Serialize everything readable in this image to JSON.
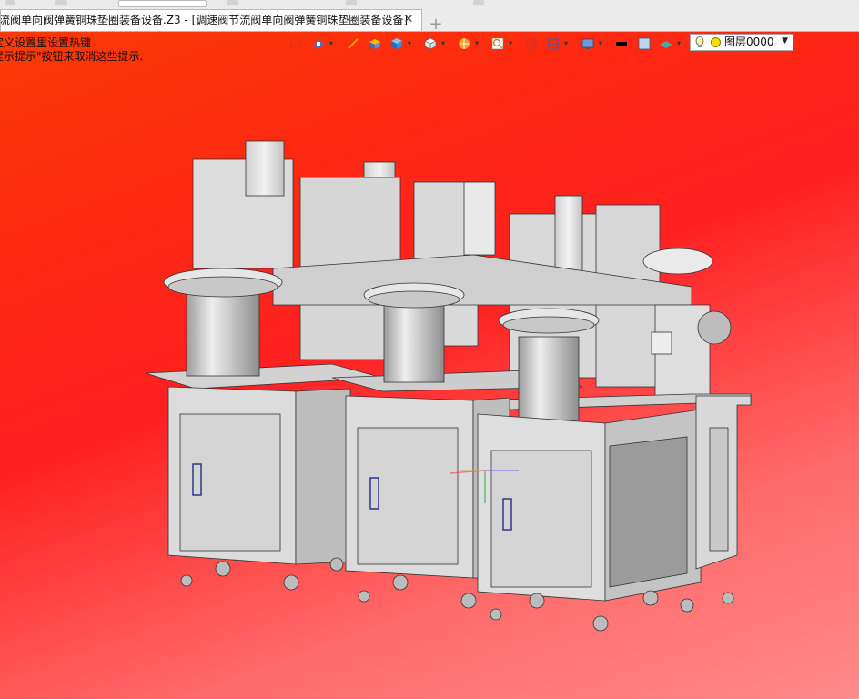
{
  "window": {
    "active_tab_title": "流阀单向阀弹簧铜珠垫圈装备设备.Z3 - [调速阀节流阀单向阀弹簧铜珠垫圈装备设备]",
    "close_glyph": "✕",
    "add_tab_glyph": "+"
  },
  "viewport": {
    "hint_line1": "定义设置里设置热键",
    "hint_line2": "提示提示\"按钮来取消这些提示.",
    "background_colors": [
      "#fb3a05",
      "#ff2020",
      "#ff8a8a"
    ]
  },
  "toolbar": {
    "items": [
      {
        "icon": "frame-select-icon"
      },
      {
        "icon": "render-mode-icon"
      },
      {
        "icon": "pencil-icon"
      },
      {
        "icon": "box-shaded-icon"
      },
      {
        "icon": "cube-blue-icon"
      },
      {
        "icon": "cube-white-icon"
      },
      {
        "icon": "sphere-orange-icon"
      },
      {
        "icon": "zoom-icon"
      },
      {
        "icon": "section-icon"
      },
      {
        "icon": "clip-plane-icon"
      },
      {
        "icon": "display-icon"
      },
      {
        "icon": "line-black-icon"
      },
      {
        "icon": "color-swatch-icon"
      },
      {
        "icon": "plane-teal-icon"
      }
    ],
    "layer": {
      "label": "图层0000",
      "icon": "lightbulb-icon"
    }
  }
}
